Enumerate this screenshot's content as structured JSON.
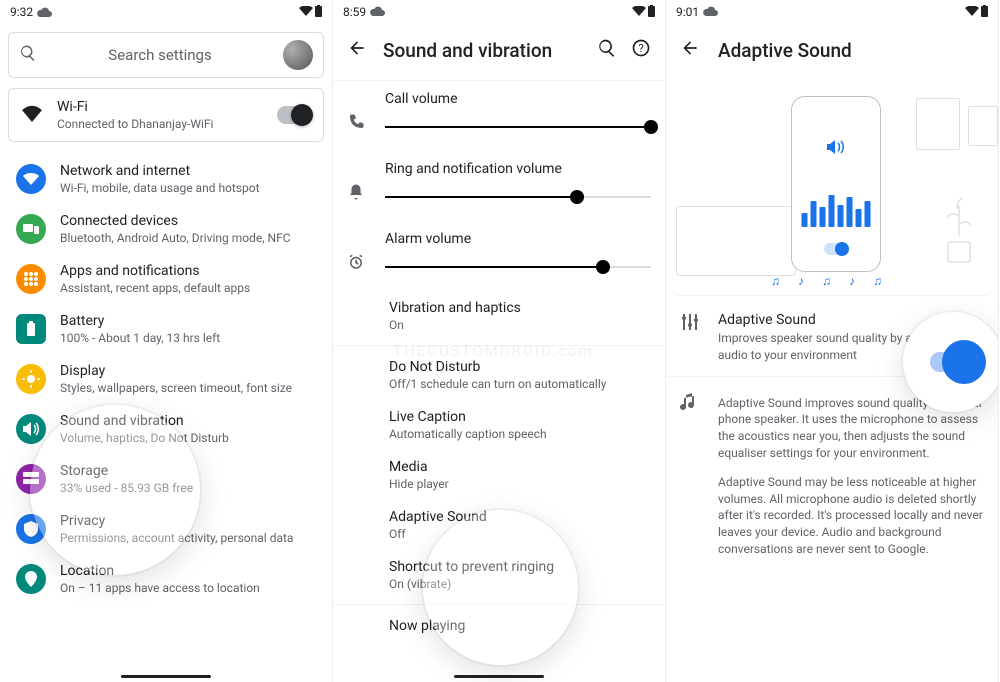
{
  "screen1": {
    "time": "9:32",
    "searchPlaceholder": "Search settings",
    "wifi": {
      "title": "Wi-Fi",
      "sub": "Connected to Dhananjay-WiFi"
    },
    "items": [
      {
        "title": "Network and internet",
        "sub": "Wi-Fi, mobile, data usage and hotspot"
      },
      {
        "title": "Connected devices",
        "sub": "Bluetooth, Android Auto, Driving mode, NFC"
      },
      {
        "title": "Apps and notifications",
        "sub": "Assistant, recent apps, default apps"
      },
      {
        "title": "Battery",
        "sub": "100% - About 1 day, 13 hrs left"
      },
      {
        "title": "Display",
        "sub": "Styles, wallpapers, screen timeout, font size"
      },
      {
        "title": "Sound and vibration",
        "sub": "Volume, haptics, Do Not Disturb"
      },
      {
        "title": "Storage",
        "sub": "33% used - 85.93 GB free"
      },
      {
        "title": "Privacy",
        "sub": "Permissions, account activity, personal data"
      },
      {
        "title": "Location",
        "sub": "On – 11 apps have access to location"
      }
    ]
  },
  "screen2": {
    "time": "8:59",
    "title": "Sound and vibration",
    "volumes": [
      {
        "title": "Call volume",
        "pct": 100
      },
      {
        "title": "Ring and notification volume",
        "pct": 72
      },
      {
        "title": "Alarm volume",
        "pct": 82
      }
    ],
    "list": [
      {
        "title": "Vibration and haptics",
        "sub": "On"
      },
      {
        "title": "Do Not Disturb",
        "sub": "Off/1 schedule can turn on automatically"
      },
      {
        "title": "Live Caption",
        "sub": "Automatically caption speech"
      },
      {
        "title": "Media",
        "sub": "Hide player"
      },
      {
        "title": "Adaptive Sound",
        "sub": "Off"
      },
      {
        "title": "Shortcut to prevent ringing",
        "sub": "On (vibrate)"
      },
      {
        "title": "Now playing",
        "sub": ""
      }
    ],
    "watermark": "THECUSTOMDROID.com"
  },
  "screen3": {
    "time": "9:01",
    "title": "Adaptive Sound",
    "toggle": {
      "title": "Adaptive Sound",
      "sub": "Improves speaker sound quality by adapting audio to your environment"
    },
    "desc1": "Adaptive Sound improves sound quality from your phone speaker. It uses the microphone to assess the acoustics near you, then adjusts the sound equaliser settings for your environment.",
    "desc2": "Adaptive Sound may be less noticeable at higher volumes. All microphone audio is deleted shortly after it's recorded. It's processed locally and never leaves your device. Audio and background conversations are never sent to Google."
  }
}
